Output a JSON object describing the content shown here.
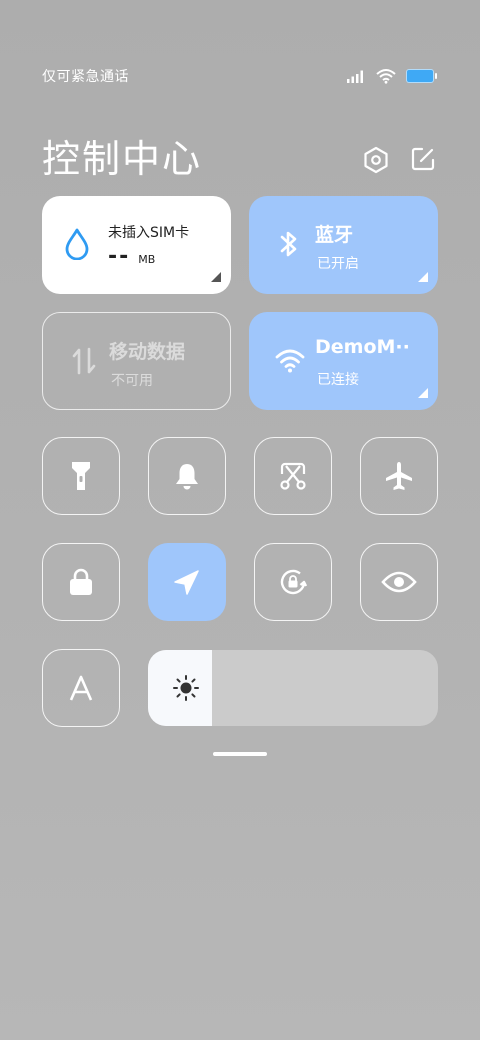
{
  "status_bar": {
    "carrier_text": "仅可紧急通话",
    "icons": [
      "signal-icon",
      "wifi-icon",
      "battery-icon"
    ],
    "battery_color": "#3fa9f5"
  },
  "header": {
    "title": "控制中心",
    "settings_icon": "hexagon-settings-icon",
    "edit_icon": "edit-icon"
  },
  "tiles": {
    "data_usage": {
      "title": "未插入SIM卡",
      "value": "--",
      "unit": "MB"
    },
    "bluetooth": {
      "title": "蓝牙",
      "status": "已开启"
    },
    "mobile_data": {
      "title": "移动数据",
      "status": "不可用"
    },
    "wifi": {
      "title": "DemoM··",
      "status": "已连接"
    }
  },
  "toggles": [
    {
      "name": "flashlight",
      "icon": "flashlight-icon",
      "active": false
    },
    {
      "name": "mute",
      "icon": "bell-icon",
      "active": false
    },
    {
      "name": "screenshot",
      "icon": "scissors-icon",
      "active": false
    },
    {
      "name": "airplane",
      "icon": "airplane-icon",
      "active": false
    },
    {
      "name": "lock",
      "icon": "lock-icon",
      "active": false
    },
    {
      "name": "location",
      "icon": "location-arrow-icon",
      "active": true
    },
    {
      "name": "auto-rotate",
      "icon": "rotate-lock-icon",
      "active": false
    },
    {
      "name": "reading-mode",
      "icon": "eye-icon",
      "active": false
    },
    {
      "name": "auto-brightness",
      "icon": "letter-a-icon",
      "active": false
    }
  ],
  "brightness": {
    "level": 0.22,
    "icon": "sun-icon"
  },
  "accent_color": "#9fc6fb"
}
